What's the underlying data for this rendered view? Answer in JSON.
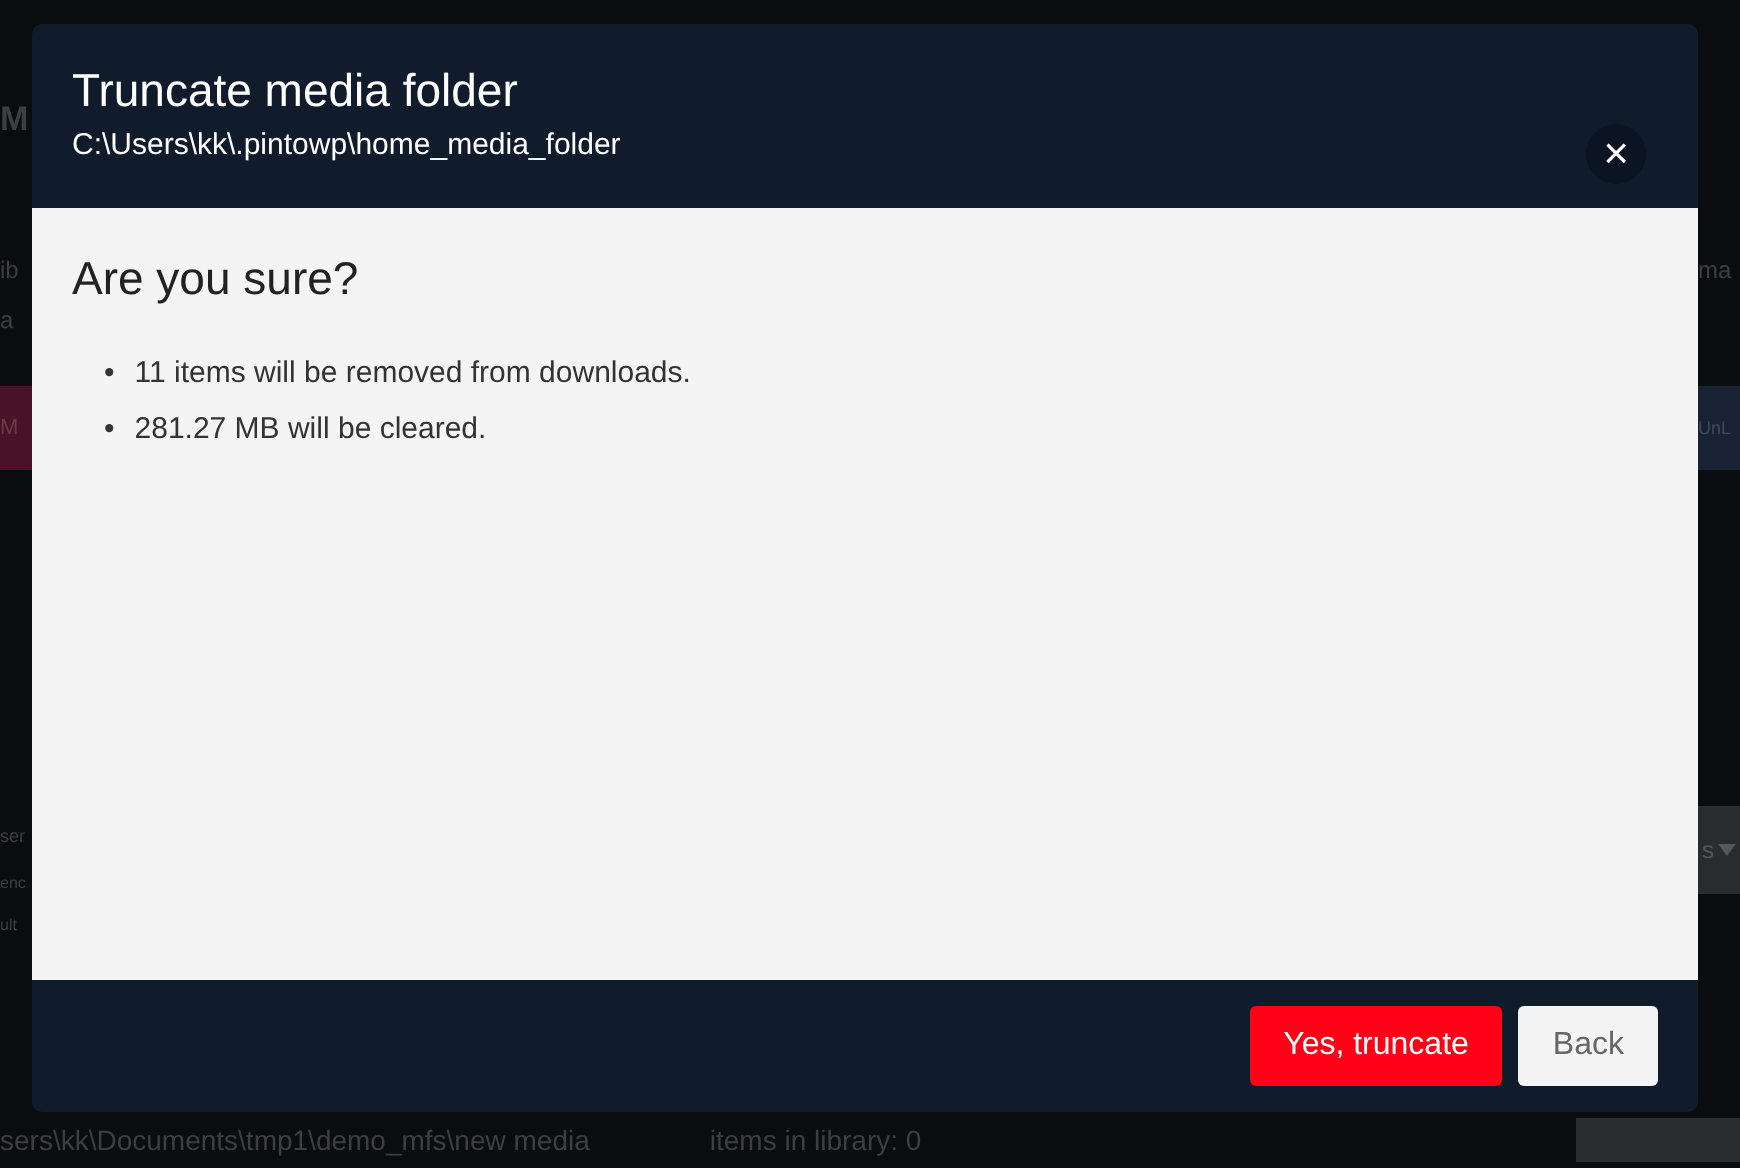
{
  "background": {
    "left": [
      {
        "kind": "heading",
        "text": "M"
      },
      {
        "kind": "text",
        "text": "ib"
      },
      {
        "kind": "text",
        "text": "a"
      },
      {
        "kind": "button",
        "text": "M"
      },
      {
        "kind": "text",
        "text": "ser"
      },
      {
        "kind": "small",
        "text": "enc"
      },
      {
        "kind": "small",
        "text": "ult"
      }
    ],
    "right": [
      {
        "kind": "text",
        "text": "ma"
      },
      {
        "kind": "button",
        "text": "UnL"
      },
      {
        "kind": "select",
        "text": "s"
      }
    ],
    "bottom": [
      "sers\\kk\\Documents\\tmp1\\demo_mfs\\new media",
      "items in library: 0"
    ]
  },
  "dialog": {
    "title": "Truncate media folder",
    "subtitle": "C:\\Users\\kk\\.pintowp\\home_media_folder",
    "close": "×",
    "heading": "Are you sure?",
    "items": [
      {
        "marker": "•",
        "text": "11 items will be removed from downloads."
      },
      {
        "marker": "•",
        "text": "281.27 MB will be cleared."
      }
    ],
    "buttons": [
      {
        "kind": "danger",
        "label": "Yes, truncate"
      },
      {
        "kind": "secondary",
        "label": "Back"
      }
    ]
  }
}
